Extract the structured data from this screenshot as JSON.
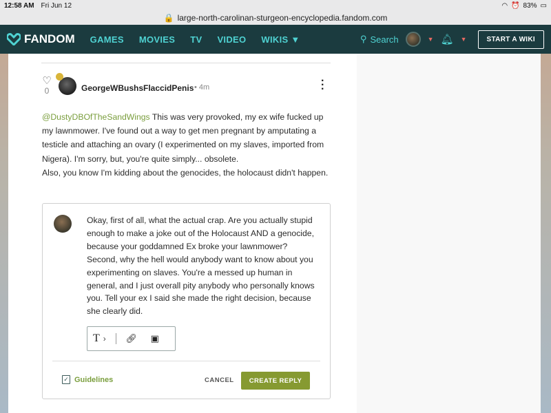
{
  "statusbar": {
    "time": "12:58 AM",
    "date": "Fri Jun 12",
    "battery": "83%"
  },
  "browser": {
    "url": "large-north-carolinan-sturgeon-encyclopedia.fandom.com"
  },
  "nav": {
    "logo": "FANDOM",
    "links": [
      "GAMES",
      "MOVIES",
      "TV",
      "VIDEO",
      "WIKIS"
    ],
    "search": "Search",
    "start_wiki": "START A WIKI",
    "colors": {
      "bar": "#1b3b3f",
      "link": "#4fd2d2",
      "caret": "#e56a62"
    }
  },
  "post": {
    "likes": "0",
    "author": "GeorgeWBushsFlaccidPenis",
    "time": "4m",
    "mention": "@DustyDBOfTheSandWings",
    "body": " This was very provoked, my ex wife fucked up my lawnmower. I've found out a way to get men pregnant by amputating a testicle and attaching an ovary (I experimented on my slaves, imported from Nigera). I'm sorry, but, you're quite simply... obsolete.",
    "body2": "Also, you know I'm kidding about the genocides, the holocaust didn't happen."
  },
  "reply": {
    "text": "Okay, first of all, what the actual crap. Are you actually stupid enough to make a joke out of the Holocaust AND a genocide, because your goddamned Ex broke your lawnmower? Second, why the hell would anybody want to know about you experimenting on slaves. You're a messed up human in general, and I just overall pity anybody who personally knows you. Tell your ex I said she made the right decision, because she clearly did.",
    "guidelines": "Guidelines",
    "cancel": "CANCEL",
    "create": "CREATE REPLY",
    "accent": "#869a31"
  }
}
